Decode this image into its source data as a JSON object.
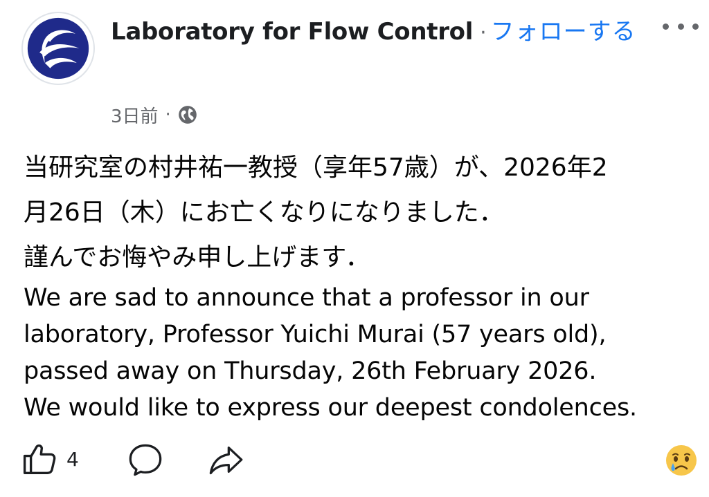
{
  "header": {
    "page_name": "Laboratory for Flow Control",
    "separator": "·",
    "follow_label": "フォローする"
  },
  "meta": {
    "time_ago": "3日前",
    "separator": "·",
    "privacy_icon": "globe-icon"
  },
  "post": {
    "jp_lines": [
      "当研究室の村井祐一教授（享年57歳）が、2026年2",
      "月26日（木）にお亡くなりになりました．",
      "謹んでお悔やみ申し上げます．"
    ],
    "en_lines": [
      "We are sad to announce that a professor in our",
      "laboratory, Professor Yuichi Murai (57 years old),",
      "passed away on Thursday, 26th February 2026.",
      "We would like to express our deepest condolences."
    ]
  },
  "actions": {
    "like_count": "4",
    "icons": [
      "like-icon",
      "comment-icon",
      "share-icon"
    ],
    "reaction": "sad-face-emoji"
  },
  "colors": {
    "accent": "#1877f2",
    "secondary_text": "#65676b",
    "logo_navy": "#1f2a8a"
  }
}
